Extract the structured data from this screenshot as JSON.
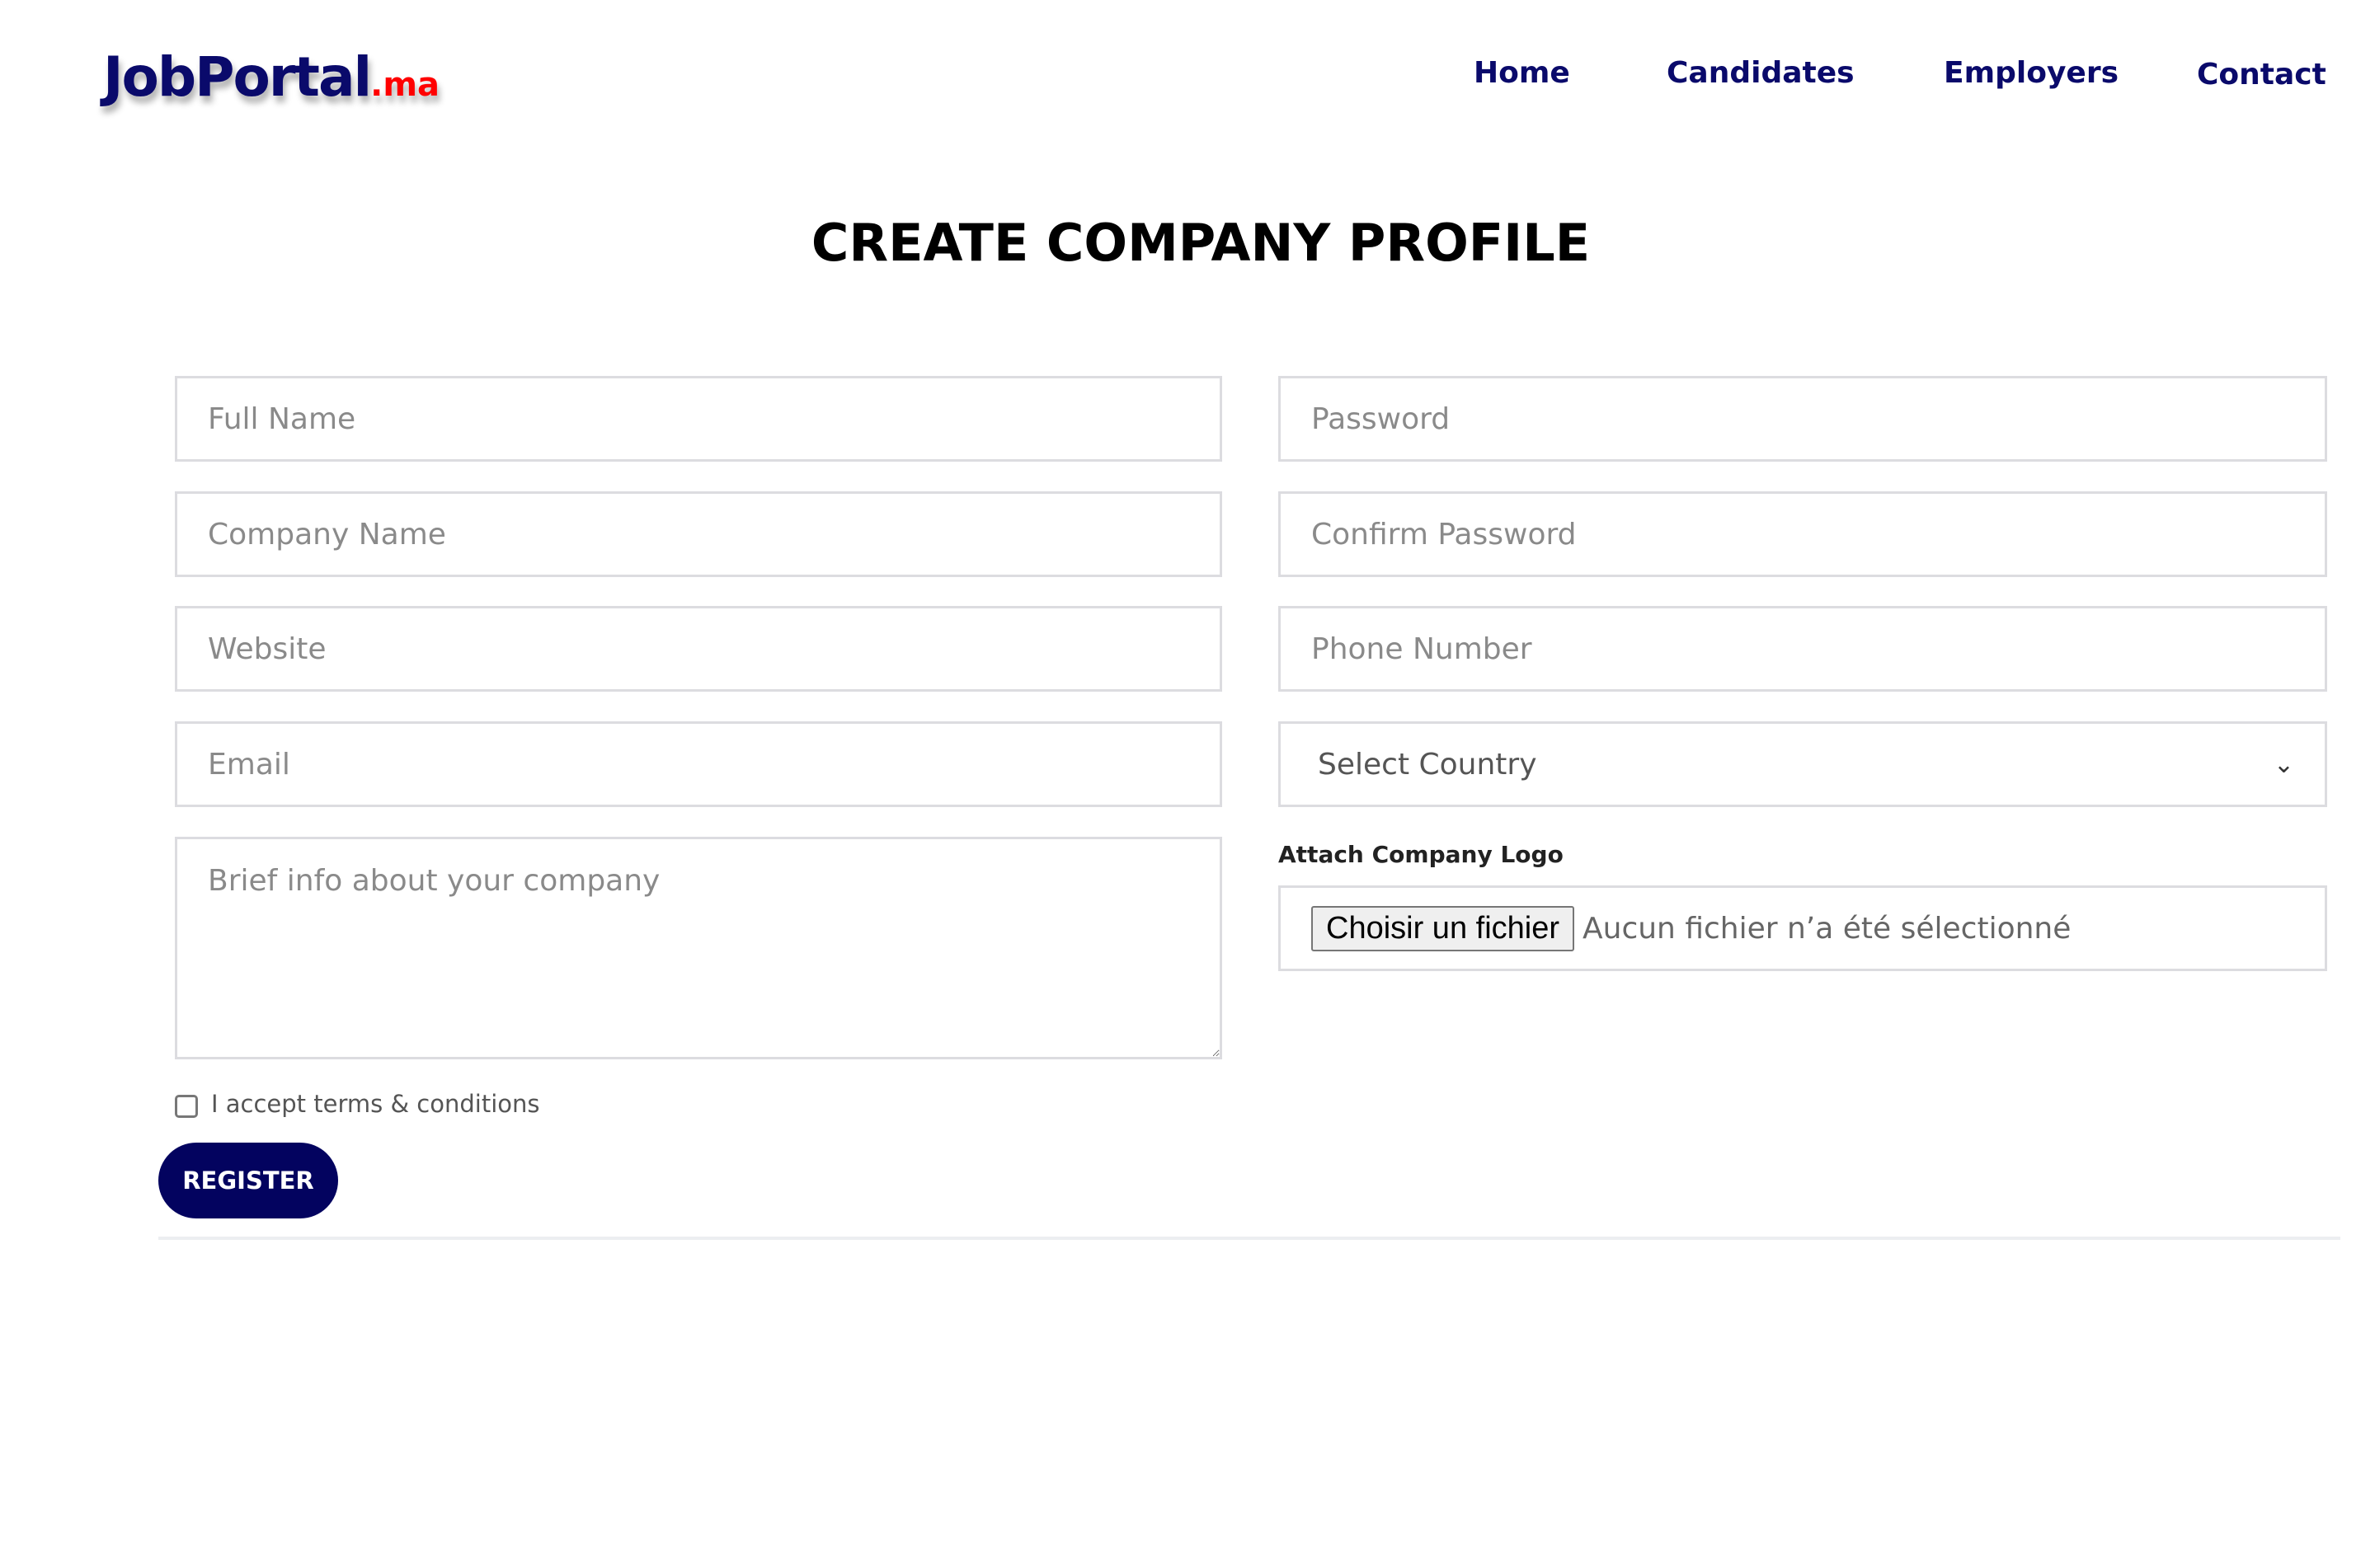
{
  "brand": {
    "name": "JobPortal",
    "tld": ".ma"
  },
  "nav": [
    {
      "label": "Home"
    },
    {
      "label": "Candidates"
    },
    {
      "label": "Employers"
    },
    {
      "label": "Contact"
    }
  ],
  "page_title": "CREATE COMPANY PROFILE",
  "form": {
    "full_name": {
      "placeholder": "Full Name",
      "value": ""
    },
    "company_name": {
      "placeholder": "Company Name",
      "value": ""
    },
    "website": {
      "placeholder": "Website",
      "value": ""
    },
    "email": {
      "placeholder": "Email",
      "value": ""
    },
    "about": {
      "placeholder": "Brief info about your company",
      "value": ""
    },
    "password": {
      "placeholder": "Password",
      "value": ""
    },
    "confirm_password": {
      "placeholder": "Confirm Password",
      "value": ""
    },
    "phone": {
      "placeholder": "Phone Number",
      "value": ""
    },
    "country": {
      "selected": "Select Country"
    },
    "logo_label": "Attach Company Logo",
    "file_button": "Choisir un fichier",
    "file_status": "Aucun fichier n’a été sélectionné",
    "terms_label": "I accept terms & conditions",
    "terms_checked": false,
    "submit": "REGISTER"
  },
  "colors": {
    "brand": "#03035f",
    "accent": "#ff0000"
  }
}
